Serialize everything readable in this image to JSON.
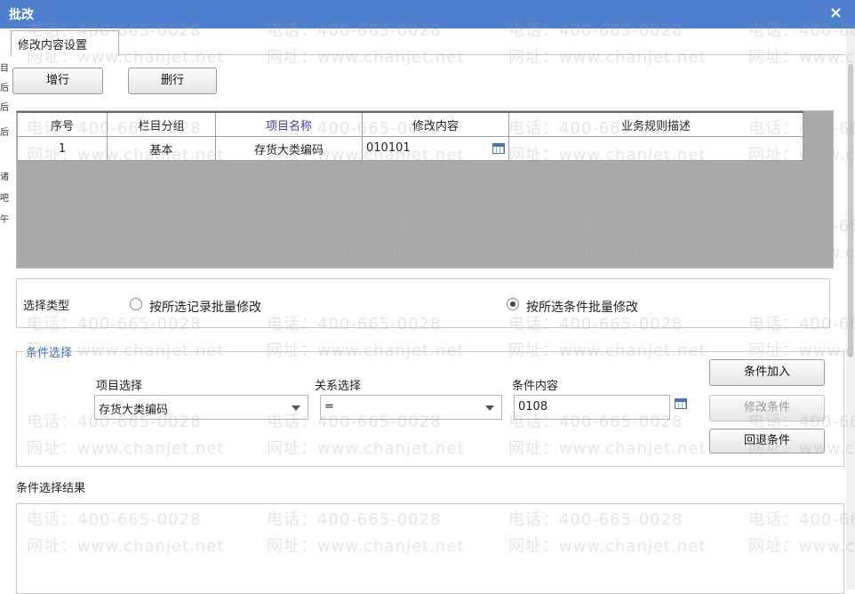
{
  "window": {
    "title": "批改",
    "close_symbol": "×"
  },
  "left_strip_chars": [
    "目",
    "后",
    "后",
    "后",
    "诸",
    "吧",
    "午"
  ],
  "tab": {
    "label": "修改内容设置"
  },
  "toolbar": {
    "add_row": "增行",
    "delete_row": "删行"
  },
  "grid": {
    "columns": [
      "序号",
      "栏目分组",
      "项目名称",
      "修改内容",
      "业务规则描述"
    ],
    "rows": [
      {
        "seq": "1",
        "group": "基本",
        "item": "存货大类编码",
        "content": "010101",
        "rule": ""
      }
    ]
  },
  "select_type": {
    "label": "选择类型",
    "option_records": "按所选记录批量修改",
    "option_conditions": "按所选条件批量修改",
    "selected": "option_conditions"
  },
  "condition": {
    "legend": "条件选择",
    "item_label": "项目选择",
    "item_value": "存货大类编码",
    "relation_label": "关系选择",
    "relation_value": "=",
    "content_label": "条件内容",
    "content_value": "0108",
    "add_button": "条件加入",
    "modify_button": "修改条件",
    "back_button": "回退条件"
  },
  "result": {
    "label": "条件选择结果"
  },
  "watermark": {
    "phone": "电话：400-665-0028",
    "site": "网址：www.chanjet.net"
  }
}
